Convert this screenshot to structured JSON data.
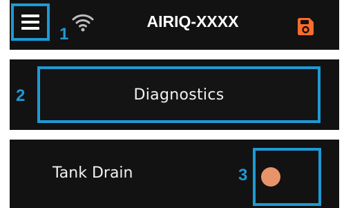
{
  "header": {
    "menu_icon": "hamburger-menu-icon",
    "wifi_icon": "wifi-icon",
    "title": "AIRIQ-XXXX",
    "action_icon": "save-icon",
    "action_icon_color": "#ff6b2c"
  },
  "diagnostics": {
    "button_label": "Diagnostics"
  },
  "tank_drain": {
    "label": "Tank Drain",
    "toggle_indicator_color": "#e8946a"
  },
  "callouts": {
    "one": "1",
    "two": "2",
    "three": "3",
    "color": "#1e9ad6"
  }
}
